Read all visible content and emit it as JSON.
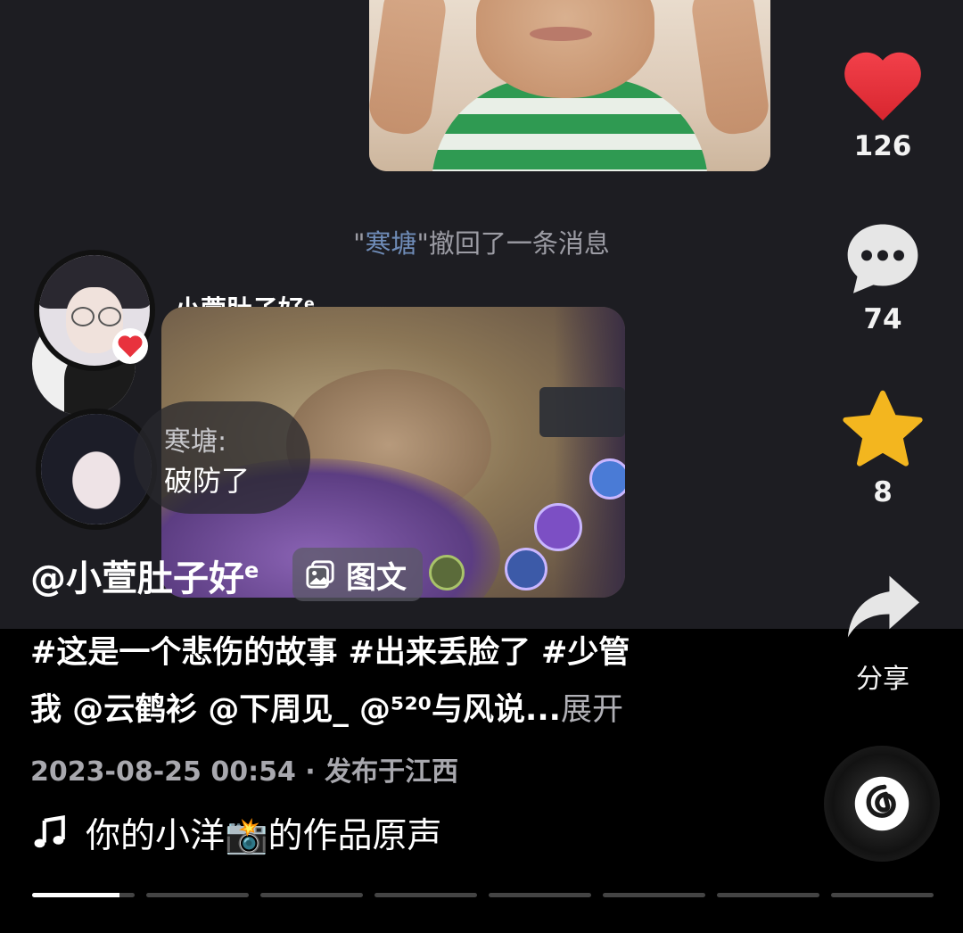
{
  "chat": {
    "recall_name": "寒塘",
    "recall_quote_open": "\"",
    "recall_quote_close": "\"",
    "recall_suffix": "撤回了一条消息",
    "sender_name": "小萱肚子好",
    "sender_sup": "e",
    "bubble_name": "寒塘:",
    "bubble_text": "破防了"
  },
  "post": {
    "author": "@小萱肚子好",
    "author_sup": "e",
    "tag_label": "图文",
    "desc_line1": "#这是一个悲伤的故事 #出来丢脸了 #少管",
    "desc_line2": "我 @云鹤衫 @下周见_ @⁵²⁰与风说...",
    "expand_label": "展开",
    "time_location": "2023-08-25 00:54 · 发布于江西",
    "music": "你的小洋📸的作品原声"
  },
  "rail": {
    "like_count": "126",
    "comment_count": "74",
    "favorite_count": "8",
    "share_label": "分享"
  },
  "progress": {
    "segments": 8,
    "active_index": 0,
    "active_fraction": 0.85
  },
  "colors": {
    "like": "#e8323d",
    "favorite": "#f3b61f",
    "recall_name": "#6f8cb8"
  }
}
